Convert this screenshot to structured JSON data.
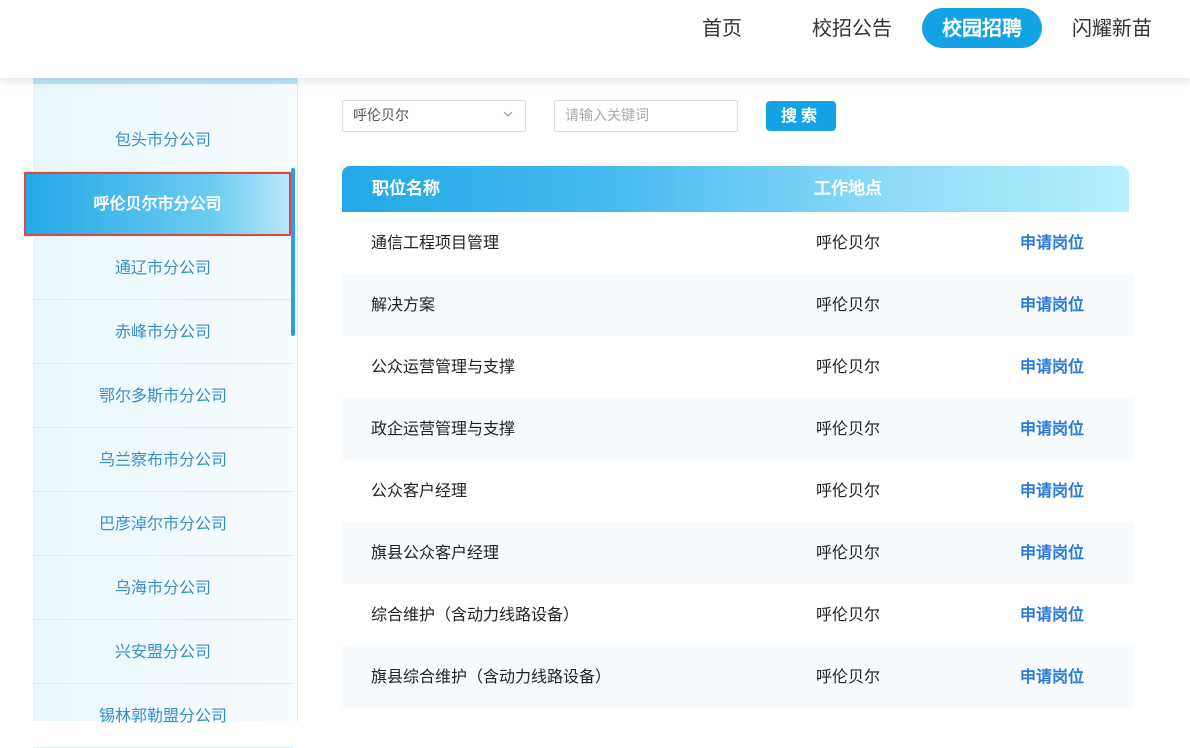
{
  "nav": {
    "items": [
      {
        "label": "首页",
        "active": false
      },
      {
        "label": "校招公告",
        "active": false
      },
      {
        "label": "校园招聘",
        "active": true
      },
      {
        "label": "闪耀新苗",
        "active": false
      }
    ]
  },
  "sidebar": {
    "items": [
      {
        "label": "包头市分公司",
        "active": false
      },
      {
        "label": "呼伦贝尔市分公司",
        "active": true
      },
      {
        "label": "通辽市分公司",
        "active": false
      },
      {
        "label": "赤峰市分公司",
        "active": false
      },
      {
        "label": "鄂尔多斯市分公司",
        "active": false
      },
      {
        "label": "乌兰察布市分公司",
        "active": false
      },
      {
        "label": "巴彦淖尔市分公司",
        "active": false
      },
      {
        "label": "乌海市分公司",
        "active": false
      },
      {
        "label": "兴安盟分公司",
        "active": false
      },
      {
        "label": "锡林郭勒盟分公司",
        "active": false
      }
    ]
  },
  "filters": {
    "city_select_value": "呼伦贝尔",
    "keyword_placeholder": "请输入关键词",
    "keyword_value": "",
    "search_label": "搜索"
  },
  "table": {
    "headers": {
      "position": "职位名称",
      "location": "工作地点"
    },
    "rows": [
      {
        "position": "通信工程项目管理",
        "location": "呼伦贝尔",
        "action": "申请岗位"
      },
      {
        "position": "解决方案",
        "location": "呼伦贝尔",
        "action": "申请岗位"
      },
      {
        "position": "公众运营管理与支撑",
        "location": "呼伦贝尔",
        "action": "申请岗位"
      },
      {
        "position": "政企运营管理与支撑",
        "location": "呼伦贝尔",
        "action": "申请岗位"
      },
      {
        "position": "公众客户经理",
        "location": "呼伦贝尔",
        "action": "申请岗位"
      },
      {
        "position": "旗县公众客户经理",
        "location": "呼伦贝尔",
        "action": "申请岗位"
      },
      {
        "position": "综合维护（含动力线路设备）",
        "location": "呼伦贝尔",
        "action": "申请岗位"
      },
      {
        "position": "旗县综合维护（含动力线路设备）",
        "location": "呼伦贝尔",
        "action": "申请岗位"
      }
    ]
  },
  "colors": {
    "accent": "#13a2e3",
    "link": "#2b7ad8",
    "highlight_border": "#e0463f"
  }
}
